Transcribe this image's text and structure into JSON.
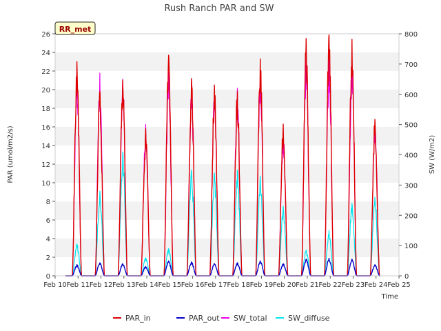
{
  "chart_data": {
    "type": "line",
    "title": "Rush Ranch PAR and SW",
    "xlabel": "Time",
    "ylabel_left": "PAR (umol/m2/s)",
    "ylabel_right": "SW (W/m2)",
    "site_badge": "RR_met",
    "y_left_range": [
      0,
      26
    ],
    "y_left_ticks": [
      0,
      2,
      4,
      6,
      8,
      10,
      12,
      14,
      16,
      18,
      20,
      22,
      24,
      26
    ],
    "y_right_range": [
      0,
      800
    ],
    "y_right_ticks": [
      0,
      100,
      200,
      300,
      400,
      500,
      600,
      700,
      800
    ],
    "x_range": [
      10,
      25
    ],
    "x_ticks": [
      "Feb 10",
      "Feb 11",
      "Feb 12",
      "Feb 13",
      "Feb 14",
      "Feb 15",
      "Feb 16",
      "Feb 17",
      "Feb 18",
      "Feb 19",
      "Feb 20",
      "Feb 21",
      "Feb 22",
      "Feb 23",
      "Feb 24",
      "Feb 25"
    ],
    "grid": "horizontal bands",
    "legend_position": "bottom",
    "series": [
      {
        "name": "PAR_in",
        "axis": "left",
        "color": "#dd0000",
        "daily_peaks": [
          23.0,
          19.8,
          21.0,
          15.8,
          23.7,
          21.2,
          20.5,
          19.8,
          23.3,
          16.3,
          25.5,
          25.9,
          25.4,
          16.8
        ]
      },
      {
        "name": "PAR_out",
        "axis": "left",
        "color": "#0000cc",
        "daily_peaks": [
          1.2,
          1.4,
          1.3,
          1.0,
          1.6,
          1.5,
          1.3,
          1.4,
          1.6,
          1.3,
          1.8,
          1.9,
          1.8,
          1.2
        ]
      },
      {
        "name": "SW_total",
        "axis": "right",
        "color": "#ee00ee",
        "daily_peaks": [
          680,
          670,
          650,
          500,
          675,
          640,
          610,
          620,
          690,
          480,
          720,
          740,
          720,
          500
        ]
      },
      {
        "name": "SW_diffuse",
        "axis": "right",
        "color": "#00e5ee",
        "daily_peaks": [
          105,
          280,
          410,
          60,
          90,
          350,
          340,
          350,
          330,
          230,
          85,
          150,
          240,
          260
        ]
      }
    ]
  },
  "legend": {
    "items": [
      {
        "label": "PAR_in",
        "color": "#dd0000"
      },
      {
        "label": "PAR_out",
        "color": "#0000cc"
      },
      {
        "label": "SW_total",
        "color": "#ee00ee"
      },
      {
        "label": "SW_diffuse",
        "color": "#00e5ee"
      }
    ]
  }
}
